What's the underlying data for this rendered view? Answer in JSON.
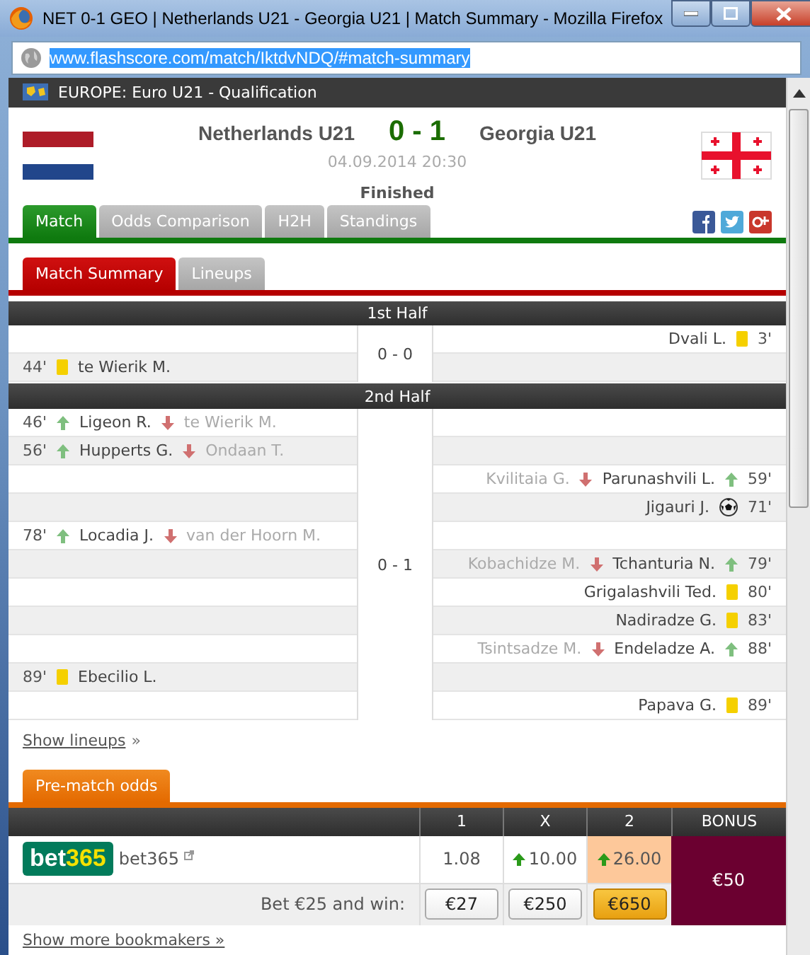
{
  "window": {
    "title": "NET 0-1 GEO | Netherlands U21 - Georgia U21 | Match Summary - Mozilla Firefox"
  },
  "address_bar": {
    "url": "www.flashscore.com/match/IktdvNDQ/#match-summary"
  },
  "league": "EUROPE: Euro U21 - Qualification",
  "match": {
    "home": "Netherlands U21",
    "score": "0 - 1",
    "away": "Georgia U21",
    "datetime": "04.09.2014 20:30",
    "status": "Finished"
  },
  "tabs": [
    {
      "label": "Match",
      "selected": true
    },
    {
      "label": "Odds Comparison",
      "selected": false
    },
    {
      "label": "H2H",
      "selected": false
    },
    {
      "label": "Standings",
      "selected": false
    }
  ],
  "sub_tabs": [
    {
      "label": "Match Summary",
      "selected": true
    },
    {
      "label": "Lineups",
      "selected": false
    }
  ],
  "halves": [
    {
      "title": "1st Half",
      "score": "0 - 0",
      "events": [
        {
          "away": {
            "minute": "3'",
            "kind": "yellow_card",
            "player": "Dvali L."
          }
        },
        {
          "home": {
            "minute": "44'",
            "kind": "yellow_card",
            "player": "te Wierik M."
          }
        }
      ]
    },
    {
      "title": "2nd Half",
      "score": "0 - 1",
      "events": [
        {
          "home": {
            "minute": "46'",
            "kind": "substitution",
            "player": "Ligeon R.",
            "player_out": "te Wierik M."
          }
        },
        {
          "home": {
            "minute": "56'",
            "kind": "substitution",
            "player": "Hupperts G.",
            "player_out": "Ondaan T."
          }
        },
        {
          "away": {
            "minute": "59'",
            "kind": "substitution",
            "player": "Parunashvili L.",
            "player_out": "Kvilitaia G."
          }
        },
        {
          "away": {
            "minute": "71'",
            "kind": "goal",
            "player": "Jigauri J."
          }
        },
        {
          "home": {
            "minute": "78'",
            "kind": "substitution",
            "player": "Locadia J.",
            "player_out": "van der Hoorn M."
          }
        },
        {
          "away": {
            "minute": "79'",
            "kind": "substitution",
            "player": "Tchanturia N.",
            "player_out": "Kobachidze M."
          }
        },
        {
          "away": {
            "minute": "80'",
            "kind": "yellow_card",
            "player": "Grigalashvili Ted."
          }
        },
        {
          "away": {
            "minute": "83'",
            "kind": "yellow_card",
            "player": "Nadiradze G."
          }
        },
        {
          "away": {
            "minute": "88'",
            "kind": "substitution",
            "player": "Endeladze A.",
            "player_out": "Tsintsadze M."
          }
        },
        {
          "home": {
            "minute": "89'",
            "kind": "yellow_card",
            "player": "Ebecilio L."
          }
        },
        {
          "away": {
            "minute": "89'",
            "kind": "yellow_card",
            "player": "Papava G."
          }
        }
      ]
    }
  ],
  "show_lineups": {
    "link": "Show lineups",
    "arrow": "»"
  },
  "odds": {
    "tab": "Pre-match odds",
    "columns": [
      "1",
      "X",
      "2",
      "BONUS"
    ],
    "bookmaker": {
      "logo_part_1": "bet",
      "logo_part_2": "365",
      "name": "bet365"
    },
    "prices": [
      {
        "value": "1.08",
        "rising": false,
        "selected": false
      },
      {
        "value": "10.00",
        "rising": true,
        "selected": false
      },
      {
        "value": "26.00",
        "rising": true,
        "selected": true
      }
    ],
    "bet_label": "Bet €25 and win:",
    "wins": [
      {
        "label": "€27",
        "selected": false
      },
      {
        "label": "€250",
        "selected": false
      },
      {
        "label": "€650",
        "selected": true
      }
    ],
    "bonus": "€50"
  },
  "show_more": "Show more bookmakers »"
}
